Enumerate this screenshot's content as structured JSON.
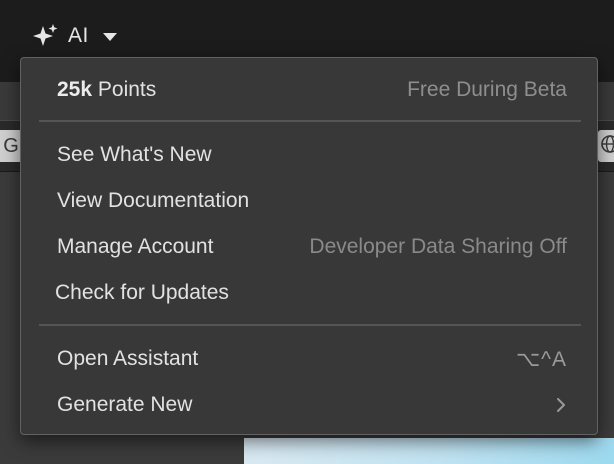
{
  "app": {
    "ai_menu_label": "AI",
    "toolbar_left_glyph": "G"
  },
  "menu": {
    "points": {
      "value": "25k",
      "unit": "Points",
      "note": "Free During Beta"
    },
    "items": [
      {
        "label": "See What's New"
      },
      {
        "label": "View Documentation"
      },
      {
        "label": "Manage Account",
        "hint": "Developer Data Sharing Off"
      },
      {
        "label": "Check for Updates"
      }
    ],
    "actions": [
      {
        "label": "Open Assistant",
        "shortcut": "⌥^A"
      },
      {
        "label": "Generate New",
        "icon": "chevron-right-icon"
      }
    ]
  },
  "colors": {
    "menu_bg": "#383838",
    "topbar_bg": "#1c1c1c",
    "hint_text": "#8e8e8e"
  }
}
